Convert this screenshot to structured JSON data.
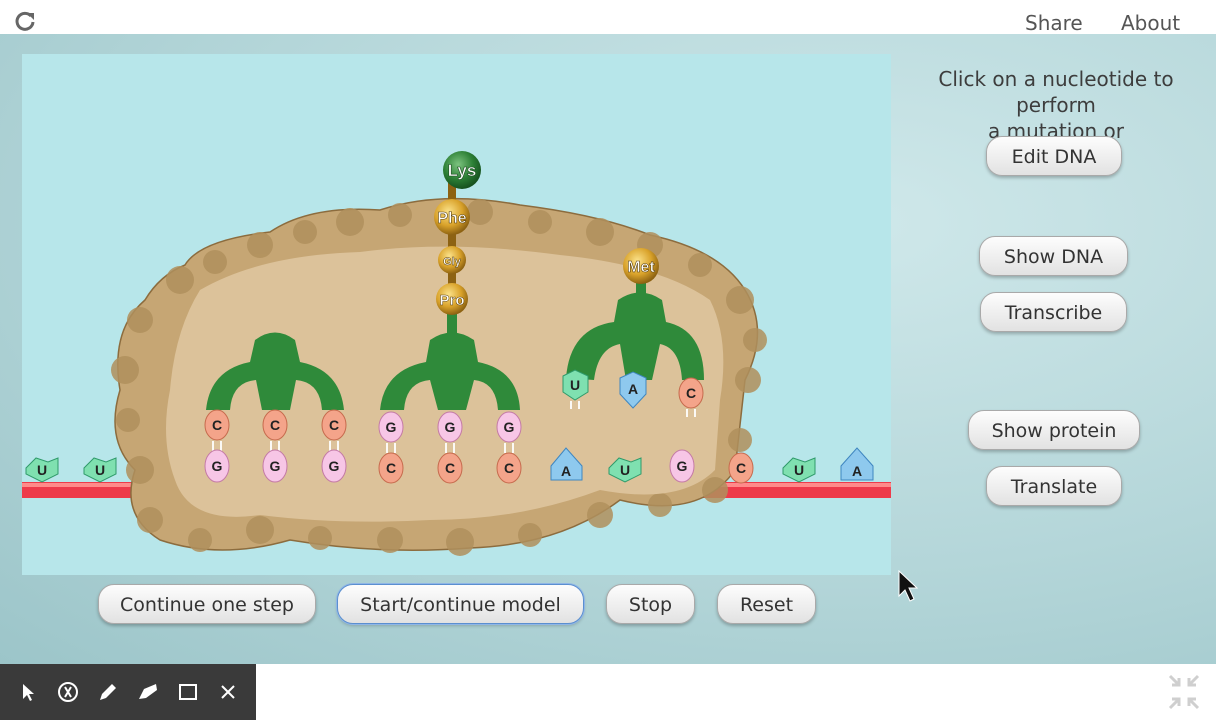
{
  "topbar": {
    "share_label": "Share",
    "about_label": "About",
    "reload_icon": "reload-icon"
  },
  "instructions": {
    "line1": "Click on a nucleotide to perform",
    "line2": "a mutation or"
  },
  "side_buttons": {
    "edit_dna": "Edit DNA",
    "show_dna": "Show DNA",
    "transcribe": "Transcribe",
    "show_protein": "Show protein",
    "translate": "Translate"
  },
  "controls": {
    "continue_step": "Continue one step",
    "start_continue": "Start/continue model",
    "stop": "Stop",
    "reset": "Reset"
  },
  "model": {
    "amino_acids": [
      "Lys",
      "Phe",
      "Gly",
      "Pro",
      "Met"
    ],
    "mrna_left": [
      "U",
      "U"
    ],
    "trna1_anticodon": [
      "C",
      "C",
      "C"
    ],
    "codon1": [
      "G",
      "G",
      "G"
    ],
    "trna2_anticodon": [
      "G",
      "G",
      "G"
    ],
    "codon2": [
      "C",
      "C",
      "C"
    ],
    "trna3_anticodon": [
      "U",
      "A",
      "C"
    ],
    "codon3": [
      "A",
      "U",
      "G"
    ],
    "mrna_right": [
      "C",
      "U",
      "A"
    ]
  },
  "colors": {
    "background": "#b7e6ea",
    "mrna_strand": "#ee3a4a",
    "trna_green": "#2f8a3a",
    "ribosome": "#d8bf96",
    "nuc_G": "#f7c6e6",
    "nuc_C": "#f4a48a",
    "nuc_U": "#7fe0b0",
    "nuc_A": "#8ec9ee",
    "toolbar": "#3a3a3a"
  },
  "toolbar": {
    "tools": [
      "pointer-tool-icon",
      "laser-tool-icon",
      "pen-tool-icon",
      "highlighter-tool-icon",
      "rectangle-tool-icon",
      "close-tool-icon"
    ]
  }
}
